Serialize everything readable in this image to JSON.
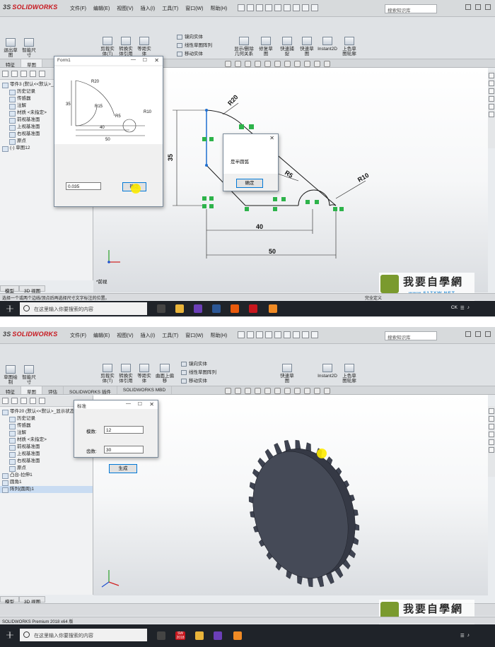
{
  "app": {
    "logo": "SOLIDWORKS",
    "search_placeholder": "搜索知识库"
  },
  "menu": [
    "文件(F)",
    "编辑(E)",
    "视图(V)",
    "插入(I)",
    "工具(T)",
    "窗口(W)",
    "帮助(H)"
  ],
  "ribbon1": {
    "sketch": "退出草图",
    "smart_dim": "智能尺寸",
    "trim": "剪裁实体(T)",
    "convert": "转换实体引用",
    "offset": "等距实体",
    "mirror": "镜向实体",
    "linear_pattern": "线性草图阵列",
    "move": "移动实体",
    "display_delete": "显示/删除几何关系",
    "repair": "修复草图",
    "quick_snap": "快速捕捉",
    "quick_view": "快速草图",
    "instant2d": "Instant2D",
    "shaded": "上色草图轮廓"
  },
  "ribbon2": {
    "sketch": "草图绘制",
    "smart_dim": "智能尺寸",
    "trim": "剪裁实体(T)",
    "convert": "转换实体引用",
    "offset": "等距实体",
    "surface_offset": "曲面上偏移",
    "mirror": "镜向实体",
    "linear_pattern": "线性草图阵列",
    "move": "移动实体",
    "quick_view": "快速草图",
    "instant2d": "Instant2D",
    "shaded": "上色草图轮廓"
  },
  "tabs1": [
    "特征",
    "草图"
  ],
  "tabs2": [
    "特征",
    "草图",
    "评估",
    "SOLIDWORKS 插件",
    "SOLIDWORKS MBD"
  ],
  "tree1": [
    {
      "label": "零件3 (默认<<默认>_显示状态 1>)",
      "sub": false,
      "sel": false
    },
    {
      "label": "历史记录",
      "sub": true,
      "sel": false
    },
    {
      "label": "传感器",
      "sub": true,
      "sel": false
    },
    {
      "label": "注解",
      "sub": true,
      "sel": false
    },
    {
      "label": "材质 <未指定>",
      "sub": true,
      "sel": false
    },
    {
      "label": "前视基准面",
      "sub": true,
      "sel": false
    },
    {
      "label": "上视基准面",
      "sub": true,
      "sel": false
    },
    {
      "label": "右视基准面",
      "sub": true,
      "sel": false
    },
    {
      "label": "原点",
      "sub": true,
      "sel": false
    },
    {
      "label": "(-) 草图12",
      "sub": false,
      "sel": false
    }
  ],
  "tree2": [
    {
      "label": "零件20 (默认<<默认>_显示状态 1>)",
      "sub": false,
      "sel": false
    },
    {
      "label": "历史记录",
      "sub": true,
      "sel": false
    },
    {
      "label": "传感器",
      "sub": true,
      "sel": false
    },
    {
      "label": "注解",
      "sub": true,
      "sel": false
    },
    {
      "label": "材质 <未指定>",
      "sub": true,
      "sel": false
    },
    {
      "label": "前视基准面",
      "sub": true,
      "sel": false
    },
    {
      "label": "上视基准面",
      "sub": true,
      "sel": false
    },
    {
      "label": "右视基准面",
      "sub": true,
      "sel": false
    },
    {
      "label": "原点",
      "sub": true,
      "sel": false
    },
    {
      "label": "凸台-拉伸1",
      "sub": false,
      "sel": false
    },
    {
      "label": "圆角1",
      "sub": false,
      "sel": false
    },
    {
      "label": "阵列(圆周)1",
      "sub": false,
      "sel": true
    }
  ],
  "form1": {
    "title": "Form1",
    "input": "0.035",
    "ok": "确定",
    "dims": {
      "r20": "R20",
      "r15": "R15",
      "r5": "R5",
      "r10": "R10",
      "d35": "35",
      "d40": "40",
      "d50": "50"
    }
  },
  "msgbox": {
    "text": "是半圆弧",
    "ok": "确定"
  },
  "drawing": {
    "r20": "R20",
    "r5": "R5",
    "r10": "R10",
    "d35": "35",
    "d40": "40",
    "d50": "50",
    "view": "*前视"
  },
  "form2": {
    "title": "标准",
    "module_label": "模数:",
    "module": "12",
    "teeth_label": "齿数:",
    "teeth": "30",
    "generate": "生成"
  },
  "status1": {
    "left": "选择一个或两个边线/顶点后再选择尺寸文字标注的位置。",
    "right": "完全定义"
  },
  "status2": {
    "left": "SOLIDWORKS Premium 2018 x64 版"
  },
  "model_tabs": [
    "模型",
    "3D 视图"
  ],
  "taskbar": {
    "search": "在这里输入你要搜索的内容",
    "ime": "CK",
    "sw": "SW 2018"
  },
  "watermark": {
    "text": "我要自學網",
    "url": "www.51ZXW.NET"
  },
  "colors": {
    "accent": "#0078d7",
    "sw_red": "#c7161d",
    "relation_green": "#2db34a",
    "taskbar": "#1f2329",
    "gear": "#4a4f5c"
  }
}
